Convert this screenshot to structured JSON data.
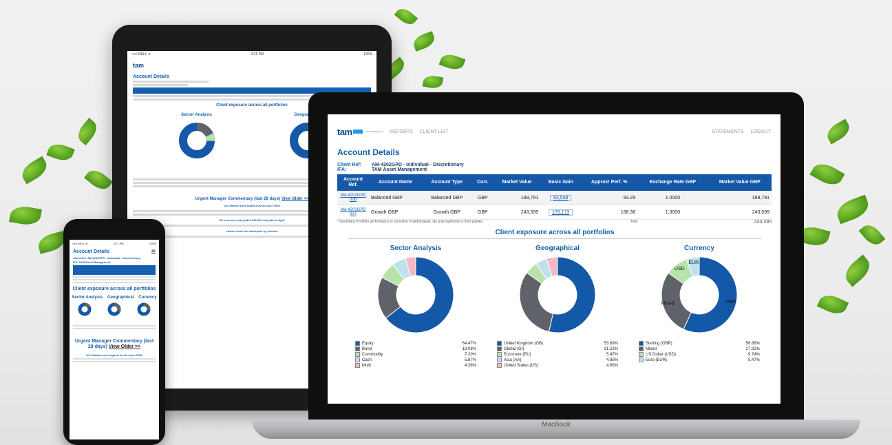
{
  "phone": {
    "status": {
      "carrier": "••••• BELL ᯤ",
      "time": "4:21 PM",
      "battery": "100%"
    },
    "title": "Account Details",
    "client_ref": "Client Ref:  AM-4202GPD - Individual - Discretionary",
    "ifa": "IFA:  TAM Asset Management",
    "exposure_title": "Client exposure across all portfolios",
    "headers": [
      "Sector Analysis",
      "Geographical",
      "Currency"
    ],
    "commentary_title": "Urgent Manager Commentary (last 28 days)",
    "view_older": "View Older >>",
    "news_headline": "US inflation sees highest levels since 2008"
  },
  "tablet": {
    "status": {
      "carrier": "••••• BELL ᯤ",
      "time": "4:21 PM",
      "battery": "100%"
    },
    "title": "Account Details",
    "exposure_title": "Client exposure across all portfolios",
    "sector": "Sector Analysis",
    "geo": "Geographical",
    "commentary_title": "Urgent Manager Commentary (last 28 days)",
    "view_older": "View Older >>",
    "headline1": "US inflation sees highest levels since 2008",
    "headline2": "US economy only added 266,000 new jobs in April",
    "headline3": "Labour loses the Hartlepool by-election"
  },
  "laptop": {
    "brand": "MacBook",
    "nav": {
      "logo": "tam",
      "logo_sub": "asset management",
      "reports": "REPORTS",
      "client_list": "CLIENT LIST",
      "statements": "STATEMENTS",
      "logout": "LOGOUT"
    },
    "title": "Account Details",
    "client_ref_label": "Client Ref:",
    "client_ref": "AM-4202GPD - Individual - Discretionary",
    "ifa_label": "IFA:",
    "ifa": "TAM Asset Management",
    "table": {
      "headers": [
        "Account Ref.",
        "Account Name",
        "Account Type",
        "Curr.",
        "Market Value",
        "Basic Gain",
        "Approx! Perf. %",
        "Exchange Rate GBP",
        "Market Value GBP"
      ],
      "rows": [
        {
          "ref": "AM-4202GPD006",
          "name": "Balanced GBP",
          "type": "Balanced GBP",
          "curr": "GBP",
          "mv": "189,791",
          "gain": "93,548",
          "perf": "93.29",
          "rate": "1.0000",
          "mvgbp": "189,791"
        },
        {
          "ref": "AM-4202GPD007",
          "name": "Growth GBP",
          "type": "Growth GBP",
          "curr": "GBP",
          "mv": "243,599",
          "gain": "178,173",
          "perf": "188.38",
          "rate": "1.0000",
          "mvgbp": "243,599"
        }
      ],
      "footnote": "* Geometric Portfolio performance is exclusive of withdrawals, tax and payments to third parties.",
      "total_label": "Total",
      "total": "433,390"
    },
    "exposure_title": "Client exposure across all portfolios",
    "panels": [
      {
        "title": "Sector Analysis",
        "items": [
          {
            "label": "Equity",
            "pct": "64.47%",
            "color": "#1458a8"
          },
          {
            "label": "Bond",
            "pct": "18.08%",
            "color": "#5f6268"
          },
          {
            "label": "Commodity",
            "pct": "7.20%",
            "color": "#b7e3a9"
          },
          {
            "label": "Cash",
            "pct": "5.87%",
            "color": "#bfe1ee"
          },
          {
            "label": "Multi",
            "pct": "4.38%",
            "color": "#f5b9c6"
          }
        ]
      },
      {
        "title": "Geographical",
        "items": [
          {
            "label": "United Kingdom (GB)",
            "pct": "53.69%",
            "color": "#1458a8"
          },
          {
            "label": "Global (GI)",
            "pct": "31.23%",
            "color": "#5f6268"
          },
          {
            "label": "Eurozone (EU)",
            "pct": "5.47%",
            "color": "#b7e3a9"
          },
          {
            "label": "Asia (AA)",
            "pct": "4.95%",
            "color": "#bfe1ee"
          },
          {
            "label": "United States (US)",
            "pct": "4.66%",
            "color": "#f5b9c6"
          }
        ]
      },
      {
        "title": "Currency",
        "items": [
          {
            "label": "Sterling (GBP)",
            "pct": "56.86%",
            "color": "#1458a8"
          },
          {
            "label": "Mixed",
            "pct": "27.92%",
            "color": "#5f6268"
          },
          {
            "label": "US Dollar (USD)",
            "pct": "9.74%",
            "color": "#b7e3a9"
          },
          {
            "label": "Euro (EUR)",
            "pct": "5.47%",
            "color": "#bfe1ee"
          }
        ],
        "slice_labels": [
          "GBP",
          "Mixed",
          "USD",
          "EUR"
        ]
      }
    ]
  }
}
